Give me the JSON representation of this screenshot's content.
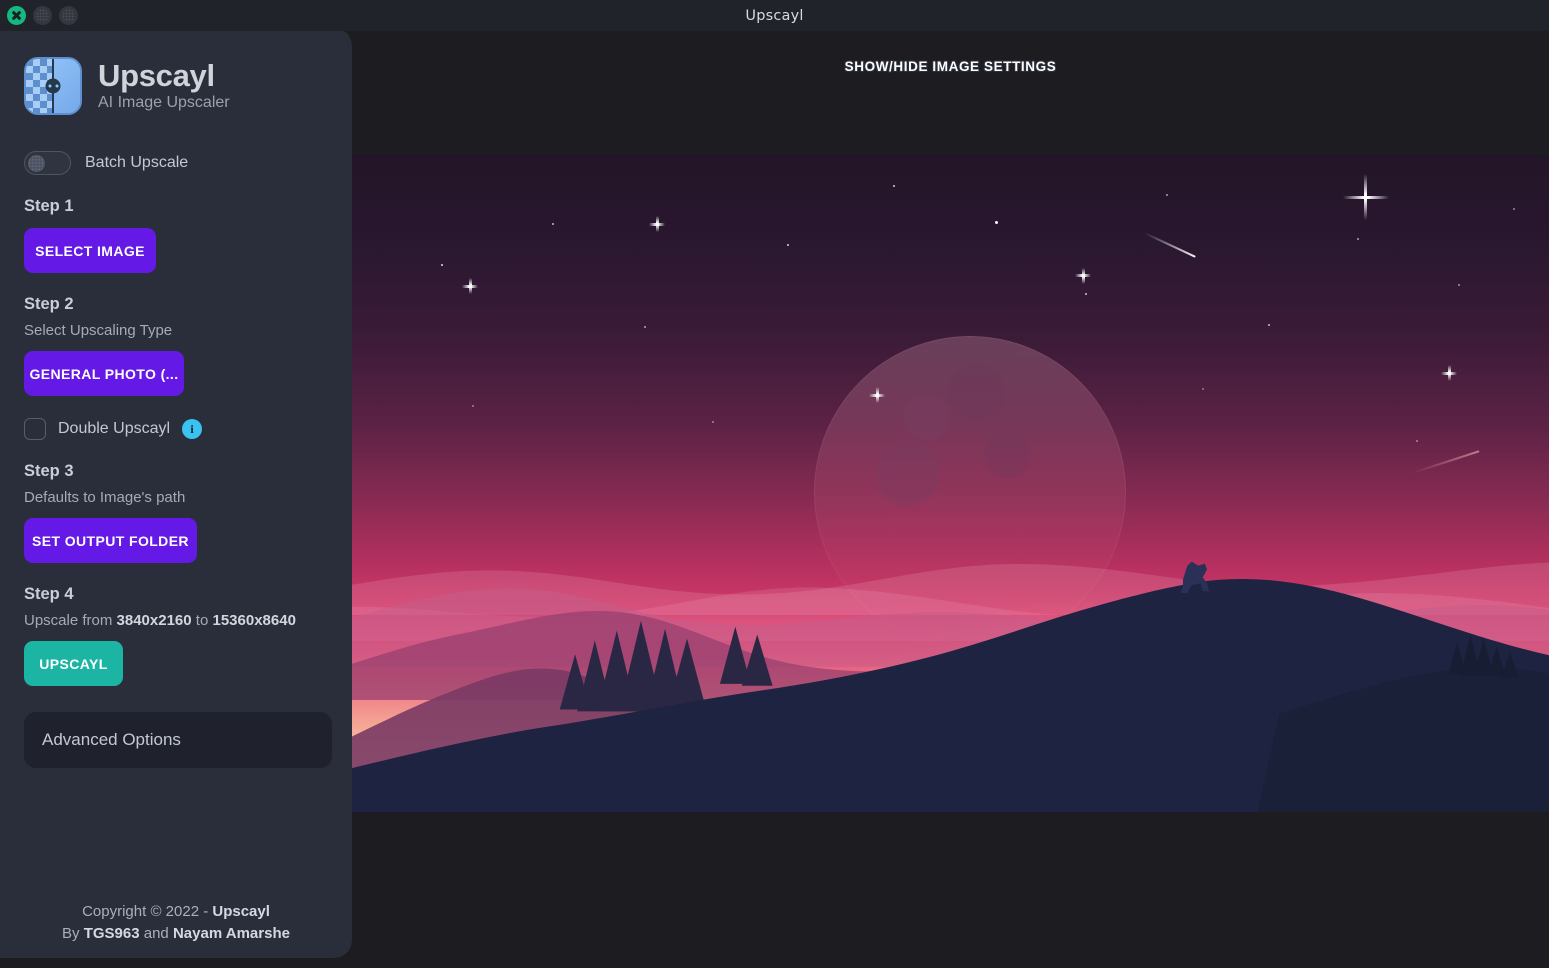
{
  "window": {
    "title": "Upscayl",
    "controls": [
      {
        "name": "close",
        "icon": "close-x-icon",
        "color": "#13b981"
      },
      {
        "name": "minimize",
        "icon": "minimize-icon",
        "color": "#33373f"
      },
      {
        "name": "maximize",
        "icon": "maximize-icon",
        "color": "#33373f"
      }
    ]
  },
  "sidebar": {
    "brand": {
      "title": "Upscayl",
      "subtitle": "AI Image Upscaler",
      "logo_icon": "upscayl-logo-icon"
    },
    "batch": {
      "label": "Batch Upscale",
      "enabled": false
    },
    "step1": {
      "title": "Step 1",
      "button": "SELECT IMAGE"
    },
    "step2": {
      "title": "Step 2",
      "subtitle": "Select Upscaling Type",
      "button": "GENERAL PHOTO (...",
      "double_upscayl": {
        "label": "Double Upscayl",
        "checked": false,
        "info_icon": "i"
      }
    },
    "step3": {
      "title": "Step 3",
      "subtitle": "Defaults to Image's path",
      "button": "SET OUTPUT FOLDER"
    },
    "step4": {
      "title": "Step 4",
      "info_prefix": "Upscale from ",
      "source_resolution": "3840x2160",
      "info_middle": " to ",
      "target_resolution": "15360x8640",
      "button": "UPSCAYL"
    },
    "advanced_options": "Advanced Options",
    "footer": {
      "line1_prefix": "Copyright © 2022 - ",
      "line1_bold": "Upscayl",
      "line2_prefix": "By ",
      "line2_bold1": "TGS963",
      "line2_middle": " and ",
      "line2_bold2": "Nayam Amarshe"
    }
  },
  "main": {
    "settings_toggle": "SHOW/HIDE IMAGE SETTINGS",
    "preview_alt": "Sunset mountain landscape with howling wolf"
  },
  "colors": {
    "accent_purple": "#6419e6",
    "accent_teal": "#1cb5a4",
    "info_cyan": "#3ac2f0",
    "sidebar_bg": "#2a2e3a",
    "app_bg": "#1d1c21",
    "titlebar_bg": "#21232b",
    "close_btn": "#13b981"
  }
}
